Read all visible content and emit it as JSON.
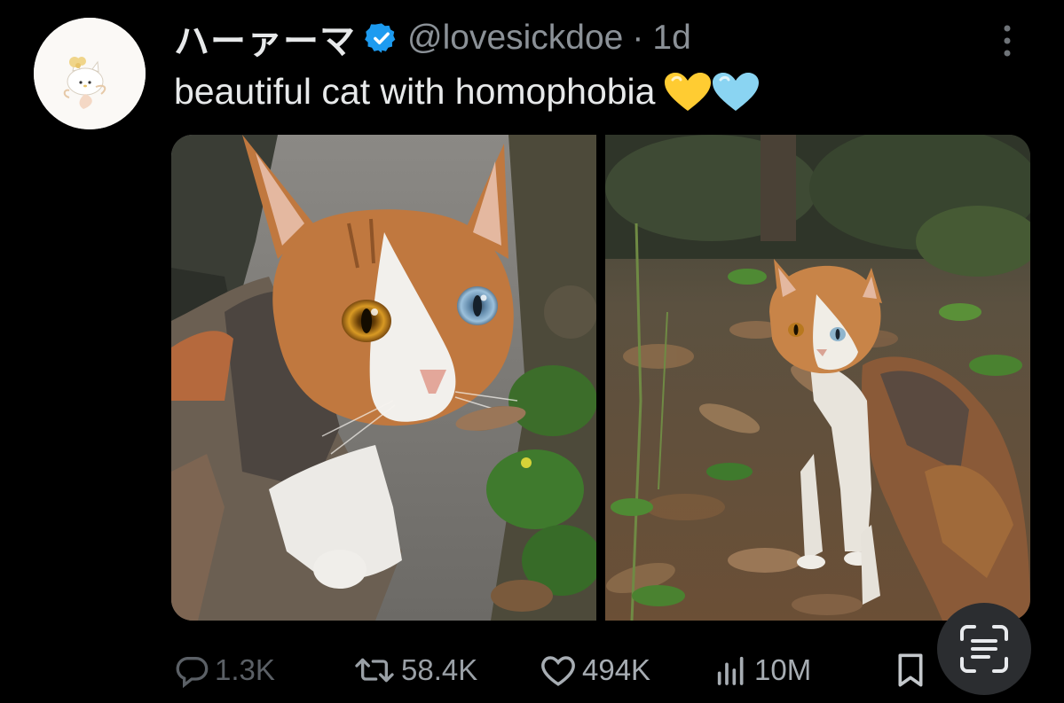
{
  "tweet": {
    "author": {
      "display_name": "ハーァーマ",
      "handle": "@lovesickdoe",
      "separator": "·",
      "time": "1d",
      "verified": true,
      "avatar_icon": "hello-kitty-avatar"
    },
    "text": "beautiful cat with homophobia",
    "emoji": [
      "yellow-heart",
      "light-blue-heart"
    ],
    "media": [
      {
        "icon": "cat-closeup-photo"
      },
      {
        "icon": "cat-in-leaves-photo"
      }
    ],
    "actions": {
      "replies": "1.3K",
      "retweets": "58.4K",
      "likes": "494K",
      "views": "10M"
    }
  },
  "colors": {
    "background": "#000000",
    "text": "#e7e9ea",
    "muted": "#8b9197",
    "verified": "#1d9bf0",
    "yellow_heart": "#ffcc32",
    "blue_heart": "#8ad4f2"
  },
  "icons": [
    "verified-badge-icon",
    "more-options-icon",
    "reply-icon",
    "retweet-icon",
    "like-icon",
    "views-icon",
    "bookmark-icon",
    "image-search-icon"
  ]
}
